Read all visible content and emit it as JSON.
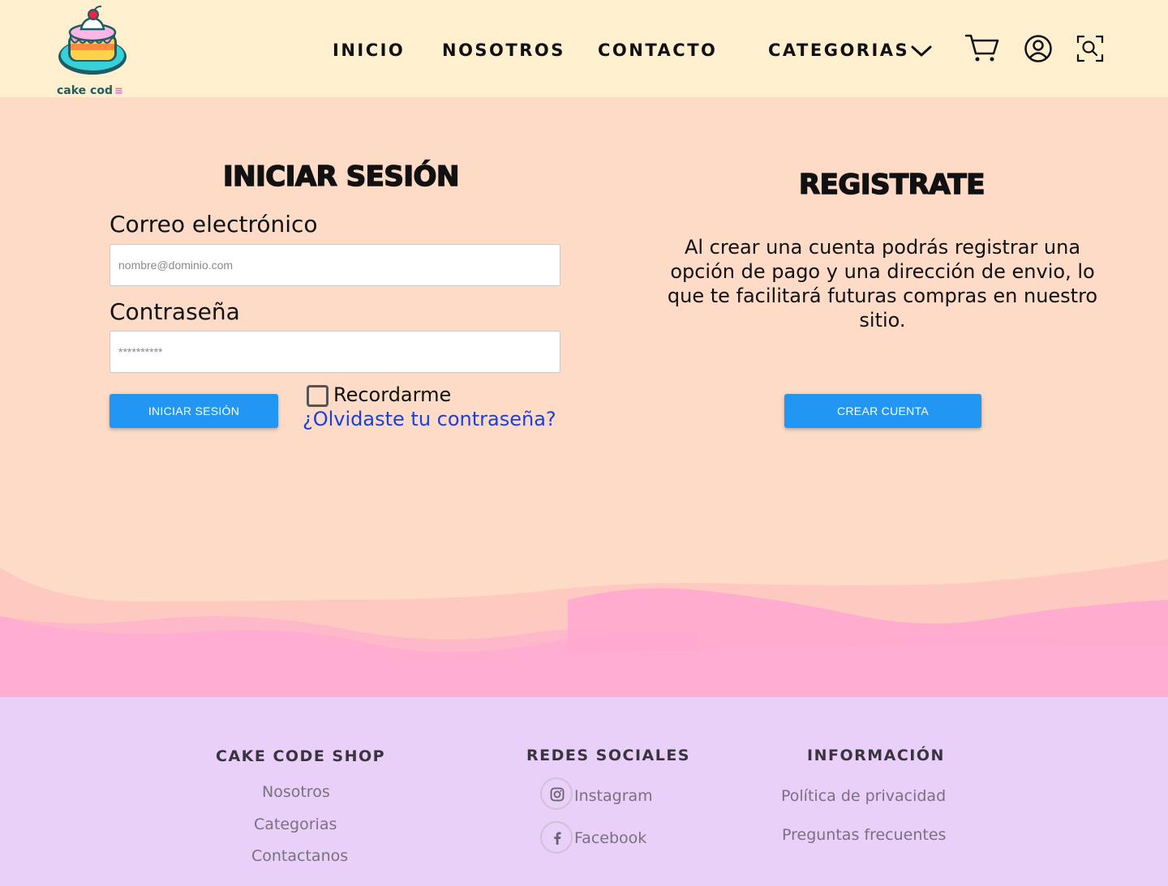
{
  "brand": {
    "name": "cake cod",
    "menu_glyph": "≡"
  },
  "nav": {
    "inicio": "INICIO",
    "nosotros": "NOSOTROS",
    "contacto": "CONTACTO",
    "categorias": "CATEGORIAS"
  },
  "header_icons": [
    "cart-icon",
    "user-icon",
    "scan-search-icon"
  ],
  "login": {
    "title": "INICIAR SESIÓN",
    "email_label": "Correo electrónico",
    "email_placeholder": "nombre@dominio.com",
    "password_label": "Contraseña",
    "password_placeholder": "**********",
    "submit_label": "INICIAR SESIÓN",
    "remember_label": "Recordarme",
    "remember_checked": false,
    "forgot_label": "¿Olvidaste tu contraseña?"
  },
  "register": {
    "title": "REGISTRATE",
    "description": "Al crear una cuenta podrás registrar una opción de pago y una dirección de envio, lo que te facilitará futuras compras en nuestro sitio.",
    "button_label": "CREAR CUENTA"
  },
  "footer": {
    "shop": {
      "heading": "CAKE CODE SHOP",
      "links": [
        "Nosotros",
        "Categorias",
        "Contactanos"
      ]
    },
    "social": {
      "heading": "REDES SOCIALES",
      "links": [
        "Instagram",
        "Facebook"
      ]
    },
    "info": {
      "heading": "INFORMACIÓN",
      "links": [
        "Política de privacidad",
        "Preguntas frecuentes"
      ]
    }
  },
  "colors": {
    "header_bg": "#feefcf",
    "main_bg": "#fddbc7",
    "footer_bg": "#e8d0f8",
    "button": "#2196f3",
    "link": "#1a3fe0",
    "wave_light": "#fdc9c1",
    "wave_pink": "#ffaed1"
  }
}
